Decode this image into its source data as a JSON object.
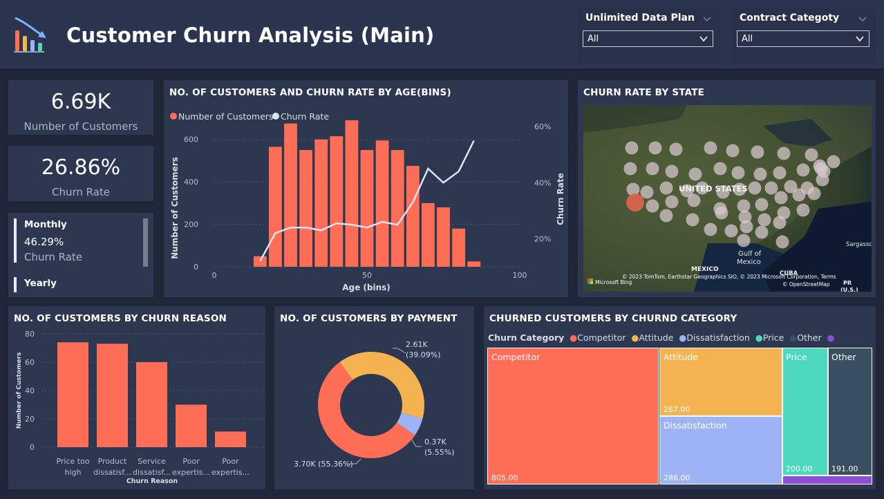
{
  "header": {
    "title": "Customer Churn Analysis (Main)"
  },
  "slicers": [
    {
      "label": "Unlimited Data Plan",
      "value": "All"
    },
    {
      "label": "Contract Categoty",
      "value": "All"
    }
  ],
  "kpis": {
    "customers": {
      "value": "6.69K",
      "label": "Number of Customers"
    },
    "churn_rate": {
      "value": "26.86%",
      "label": "Churn Rate"
    }
  },
  "contract_card": {
    "items": [
      {
        "name": "Monthly",
        "value": "46.29%",
        "label": "Churn Rate"
      },
      {
        "name": "Yearly"
      }
    ]
  },
  "age_chart": {
    "title": "NO. OF CUSTOMERS AND CHURN RATE BY AGE(BINS)",
    "legend": [
      "Number of Customers",
      "Churn Rate"
    ],
    "ylabel": "Number of Customers",
    "y2label": "Churn Rate",
    "xlabel": "Age (bins)",
    "yticks": [
      "0",
      "200",
      "400",
      "600"
    ],
    "y2ticks": [
      "20%",
      "40%",
      "60%"
    ],
    "xticks": [
      "0",
      "50",
      "100"
    ]
  },
  "map": {
    "title": "CHURN RATE BY STATE",
    "labels": {
      "country": "UNITED STATES",
      "gulf": "Gulf of\nMexico",
      "mexico": "MEXICO",
      "cuba": "CUBA",
      "sargasso": "Sargasso",
      "pr": "PR\n(U.S.)"
    },
    "attribution": "© 2023 TomTom, Earthstar Geographics SIO, © 2023 Microsoft Corporation, Terms\n© OpenStreetMap",
    "bing": "Microsoft Bing"
  },
  "reason_chart": {
    "title": "NO. OF CUSTOMERS BY CHURN REASON",
    "ylabel": "Number of Customers",
    "xlabel": "Churn Reason",
    "yticks": [
      "0",
      "20",
      "40",
      "60",
      "80"
    ],
    "categories": [
      [
        "Price too",
        "high"
      ],
      [
        "Product",
        "dissatisf..."
      ],
      [
        "Service",
        "dissatisf..."
      ],
      [
        "Poor",
        "expertis..."
      ],
      [
        "Poor",
        "expertis..."
      ]
    ]
  },
  "payment_chart": {
    "title": "NO. OF CUSTOMERS BY PAYMENT",
    "labels": [
      {
        "line1": "2.61K",
        "line2": "(39.09%)"
      },
      {
        "line1": "0.37K",
        "line2": "(5.55%)"
      },
      {
        "line1": "3.70K (55.36%)",
        "line2": ""
      }
    ]
  },
  "category_chart": {
    "title": "CHURNED CUSTOMERS BY CHURND CATEGORY",
    "legend_title": "Churn Category",
    "legend": [
      "Competitor",
      "Attitude",
      "Dissatisfaction",
      "Price",
      "Other"
    ],
    "cells": [
      {
        "name": "Competitor",
        "value": "805.00"
      },
      {
        "name": "Attitude",
        "value": "287.00"
      },
      {
        "name": "Dissatisfaction",
        "value": "286.00"
      },
      {
        "name": "Price",
        "value": "200.00"
      },
      {
        "name": "Other",
        "value": "191.00"
      }
    ]
  },
  "colors": {
    "coral": "#fe6d56",
    "line": "#dce3f5",
    "orange": "#f4b350",
    "blue": "#9db3f5",
    "teal": "#4dd8c0",
    "slate": "#3b4f62",
    "purple": "#8a4fd6"
  },
  "chart_data": [
    {
      "type": "bar",
      "title": "NO. OF CUSTOMERS AND CHURN RATE BY AGE(BINS)",
      "xlabel": "Age (bins)",
      "ylabel": "Number of Customers",
      "y2label": "Churn Rate",
      "xlim": [
        0,
        100
      ],
      "ylim": [
        0,
        700
      ],
      "y2lim": [
        10,
        63
      ],
      "x": [
        15,
        20,
        25,
        30,
        35,
        40,
        45,
        50,
        55,
        60,
        65,
        70,
        75,
        80,
        85
      ],
      "series": [
        {
          "name": "Number of Customers",
          "type": "bar",
          "values": [
            50,
            565,
            675,
            550,
            600,
            615,
            690,
            550,
            595,
            550,
            475,
            300,
            280,
            180,
            25
          ]
        },
        {
          "name": "Churn Rate",
          "type": "line",
          "axis": "right",
          "values": [
            12,
            22,
            24,
            24,
            23,
            25.5,
            25,
            24,
            26,
            25,
            33,
            45,
            40,
            44,
            55
          ]
        }
      ]
    },
    {
      "type": "bar",
      "title": "NO. OF CUSTOMERS BY CHURN REASON",
      "xlabel": "Churn Reason",
      "ylabel": "Number of Customers",
      "ylim": [
        0,
        80
      ],
      "categories": [
        "Price too high",
        "Product dissatisf...",
        "Service dissatisf...",
        "Poor expertis...",
        "Poor expertis..."
      ],
      "values": [
        74,
        73,
        60,
        30,
        11
      ]
    },
    {
      "type": "pie",
      "title": "NO. OF CUSTOMERS BY PAYMENT",
      "values": [
        3700,
        2610,
        370
      ],
      "percentages": [
        55.36,
        39.09,
        5.55
      ]
    },
    {
      "type": "treemap",
      "title": "CHURNED CUSTOMERS BY CHURND CATEGORY",
      "categories": [
        "Competitor",
        "Attitude",
        "Dissatisfaction",
        "Price",
        "Other"
      ],
      "values": [
        805,
        287,
        286,
        200,
        191
      ]
    }
  ]
}
